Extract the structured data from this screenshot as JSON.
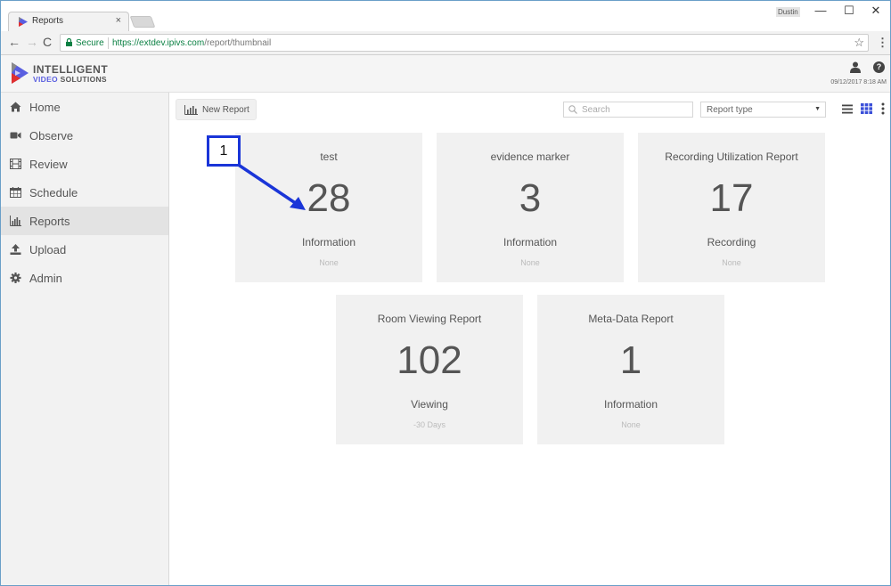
{
  "browser": {
    "tab_title": "Reports",
    "tab_close": "×",
    "profile_name": "Dustin",
    "window_controls": {
      "minimize": "—",
      "maximize": "☐",
      "close": "✕"
    },
    "nav": {
      "back": "←",
      "forward": "→",
      "reload": "C"
    },
    "secure_label": "Secure",
    "url_host": "https://extdev.ipivs.com",
    "url_path": "/report/thumbnail",
    "star": "☆",
    "menu": "⋮"
  },
  "header": {
    "logo_line1": "INTELLIGENT",
    "logo_line2_a": "VIDEO",
    "logo_line2_b": " SOLUTIONS",
    "user_icon": "user-icon",
    "help_label": "?",
    "datetime": "09/12/2017 8:18 AM"
  },
  "sidebar": {
    "items": [
      {
        "label": "Home",
        "icon": "home-icon",
        "active": false
      },
      {
        "label": "Observe",
        "icon": "video-camera-icon",
        "active": false
      },
      {
        "label": "Review",
        "icon": "film-icon",
        "active": false
      },
      {
        "label": "Schedule",
        "icon": "calendar-icon",
        "active": false
      },
      {
        "label": "Reports",
        "icon": "bar-chart-icon",
        "active": true
      },
      {
        "label": "Upload",
        "icon": "upload-icon",
        "active": false
      },
      {
        "label": "Admin",
        "icon": "gear-icon",
        "active": false
      }
    ]
  },
  "toolbar": {
    "new_report_label": "New Report",
    "search_placeholder": "Search",
    "search_value": "",
    "report_type_selected": "Report type",
    "select_caret": "▼"
  },
  "reports": [
    {
      "title": "test",
      "count": "28",
      "category": "Information",
      "period": "None"
    },
    {
      "title": "evidence marker",
      "count": "3",
      "category": "Information",
      "period": "None"
    },
    {
      "title": "Recording Utilization Report",
      "count": "17",
      "category": "Recording",
      "period": "None"
    },
    {
      "title": "Room Viewing Report",
      "count": "102",
      "category": "Viewing",
      "period": "-30 Days"
    },
    {
      "title": "Meta-Data Report",
      "count": "1",
      "category": "Information",
      "period": "None"
    }
  ],
  "annotation": {
    "number": "1",
    "color": "#1a35d8"
  },
  "colors": {
    "accent_blue": "#5a5fe0",
    "secure_green": "#0b8043",
    "card_bg": "#f1f1f1",
    "sidebar_bg": "#f2f2f2",
    "sidebar_active_bg": "#e3e3e3"
  }
}
